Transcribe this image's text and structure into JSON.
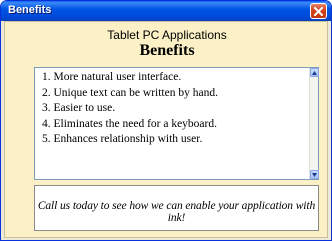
{
  "window": {
    "title": "Benefits"
  },
  "header": {
    "subtitle": "Tablet PC Applications",
    "title": "Benefits"
  },
  "benefits": {
    "items": [
      "1. More natural user interface.",
      "2. Unique text can be written by hand.",
      "3. Easier to use.",
      "4. Eliminates the need for a keyboard.",
      "5. Enhances relationship with user."
    ]
  },
  "cta": {
    "text": "Call us today to see how we can enable your application with ink!"
  },
  "icons": {
    "close": "close-icon",
    "scroll_up": "scroll-up-arrow-icon",
    "scroll_down": "scroll-down-arrow-icon"
  },
  "colors": {
    "titlebar": "#0055e5",
    "panel_background": "#fcf1c6",
    "close_button": "#d4421b"
  }
}
